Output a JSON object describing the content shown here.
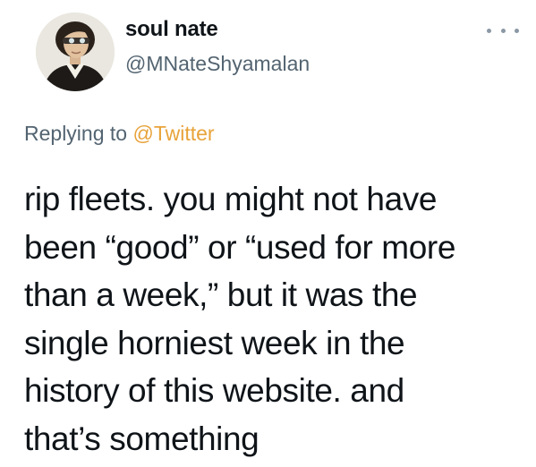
{
  "tweet": {
    "author": {
      "display_name": "soul nate",
      "handle": "@MNateShyamalan",
      "avatar_icon": "portrait-avatar"
    },
    "more_icon": "more-options-icon",
    "reply": {
      "prefix": "Replying to ",
      "mention": "@Twitter",
      "mention_color": "#e8a33a"
    },
    "text_lines": [
      "rip fleets. you might not have",
      "been “good” or “used for more",
      "than a week,” but it was the",
      "single horniest week in the",
      "history of this website. and",
      "that’s something"
    ]
  }
}
